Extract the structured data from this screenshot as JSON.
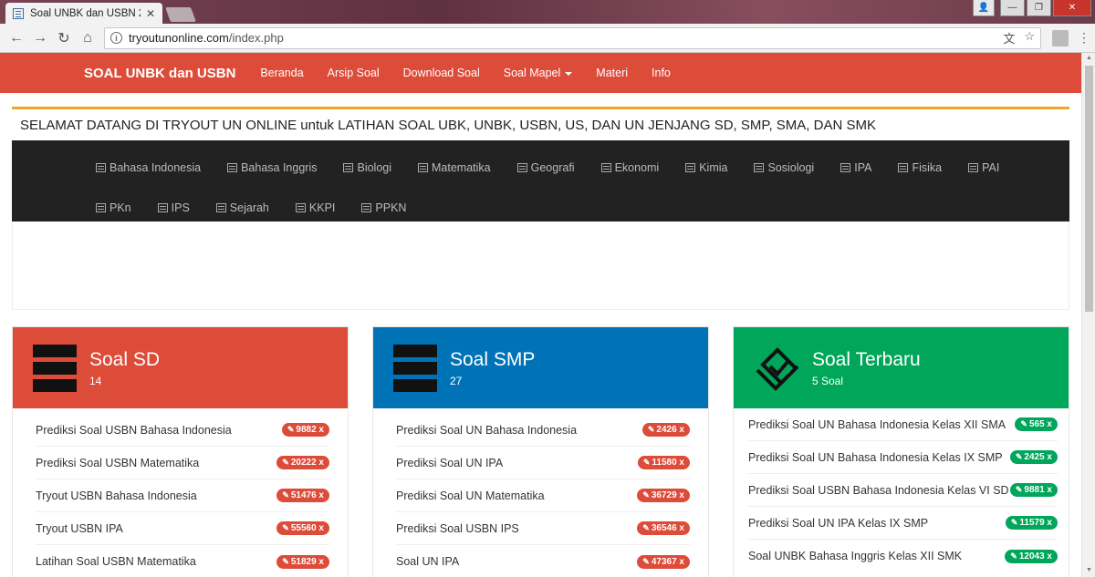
{
  "browser": {
    "tab_title": "Soal UNBK dan USBN 20",
    "url_host": "tryoutunonline.com",
    "url_path": "/index.php"
  },
  "navbar": {
    "brand": "SOAL UNBK dan USBN",
    "links": [
      "Beranda",
      "Arsip Soal",
      "Download Soal",
      "Soal Mapel",
      "Materi",
      "Info"
    ]
  },
  "welcome": "SELAMAT DATANG DI TRYOUT UN ONLINE untuk LATIHAN SOAL UBK, UNBK, USBN, US, DAN UN JENJANG SD, SMP, SMA, DAN SMK",
  "subjects": [
    "Bahasa Indonesia",
    "Bahasa Inggris",
    "Biologi",
    "Matematika",
    "Geografi",
    "Ekonomi",
    "Kimia",
    "Sosiologi",
    "IPA",
    "Fisika",
    "PAI",
    "PKn",
    "IPS",
    "Sejarah",
    "KKPI",
    "PPKN"
  ],
  "cards": [
    {
      "title": "Soal SD",
      "count": "14",
      "color": "#dd4b39",
      "items": [
        {
          "label": "Prediksi Soal USBN Bahasa Indonesia",
          "views": "9882 x"
        },
        {
          "label": "Prediksi Soal USBN Matematika",
          "views": "20222 x"
        },
        {
          "label": "Tryout USBN Bahasa Indonesia",
          "views": "51476 x"
        },
        {
          "label": "Tryout USBN IPA",
          "views": "55560 x"
        },
        {
          "label": "Latihan Soal USBN Matematika",
          "views": "51829 x"
        }
      ]
    },
    {
      "title": "Soal SMP",
      "count": "27",
      "color": "#0073b7",
      "items": [
        {
          "label": "Prediksi Soal UN Bahasa Indonesia",
          "views": "2426 x"
        },
        {
          "label": "Prediksi Soal UN IPA",
          "views": "11580 x"
        },
        {
          "label": "Prediksi Soal UN Matematika",
          "views": "36729 x"
        },
        {
          "label": "Prediksi Soal USBN IPS",
          "views": "36546 x"
        },
        {
          "label": "Soal UN IPA",
          "views": "47367 x"
        }
      ]
    },
    {
      "title": "Soal Terbaru",
      "count": "5 Soal",
      "color": "#00a65a",
      "items": [
        {
          "label": "Prediksi Soal UN Bahasa Indonesia Kelas XII SMA",
          "views": "565 x"
        },
        {
          "label": "Prediksi Soal UN Bahasa Indonesia Kelas IX SMP",
          "views": "2425 x"
        },
        {
          "label": "Prediksi Soal USBN Bahasa Indonesia Kelas VI SD",
          "views": "9881 x"
        },
        {
          "label": "Prediksi Soal UN IPA Kelas IX SMP",
          "views": "11579 x"
        },
        {
          "label": "Soal UNBK Bahasa Inggris Kelas XII SMK",
          "views": "12043 x"
        }
      ]
    }
  ]
}
